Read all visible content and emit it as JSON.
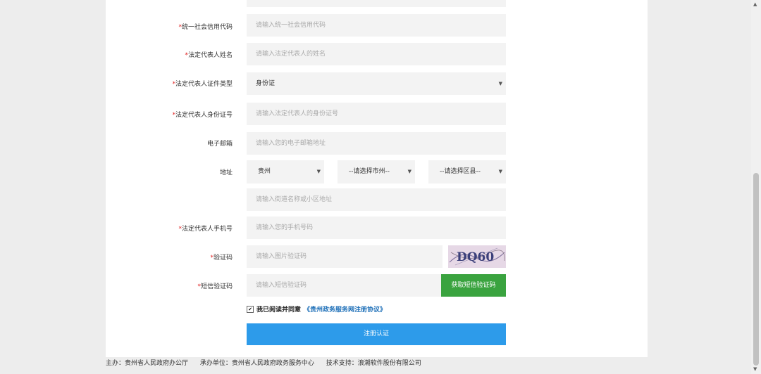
{
  "form": {
    "credit_code": {
      "label": "统一社会信用代码",
      "placeholder": "请输入统一社会信用代码"
    },
    "legal_name": {
      "label": "法定代表人姓名",
      "placeholder": "请输入法定代表人的姓名"
    },
    "id_type": {
      "label": "法定代表人证件类型",
      "value": "身份证"
    },
    "id_number": {
      "label": "法定代表人身份证号",
      "placeholder": "请输入法定代表人的身份证号"
    },
    "email": {
      "label": "电子邮箱",
      "placeholder": "请输入您的电子邮箱地址"
    },
    "address": {
      "label": "地址",
      "province": "贵州",
      "city": "--请选择市州--",
      "district": "--请选择区县--",
      "street_placeholder": "请输入街道名称或小区地址"
    },
    "phone": {
      "label": "法定代表人手机号",
      "placeholder": "请输入您的手机号码"
    },
    "captcha": {
      "label": "验证码",
      "placeholder": "请输入图片验证码",
      "image_text": "DQ60"
    },
    "sms": {
      "label": "短信验证码",
      "placeholder": "请输入短信验证码",
      "button": "获取短信验证码"
    },
    "agree": {
      "text": "我已阅读并同意",
      "link": "《贵州政务服务网注册协议》",
      "checked": true
    },
    "submit": "注册认证",
    "required_mark": "*"
  },
  "footer": {
    "host": "主办：贵州省人民政府办公厅",
    "organizer": "承办单位：贵州省人民政府政务服务中心",
    "tech": "技术支持：浪潮软件股份有限公司"
  },
  "colors": {
    "primary": "#2d9bea",
    "sms_button": "#3aa33f",
    "required": "#e02020",
    "link": "#1d6fb8"
  }
}
